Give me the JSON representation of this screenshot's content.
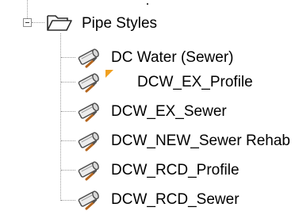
{
  "tree": {
    "root": {
      "label": "Pipe Styles",
      "icon": "folder-open-icon",
      "expanded": true
    },
    "items": [
      {
        "label": "DC Water (Sewer)",
        "icon": "pipe-style-icon",
        "flagged": false
      },
      {
        "label": "DCW_EX_Profile",
        "icon": "pipe-style-icon",
        "flagged": true
      },
      {
        "label": "DCW_EX_Sewer",
        "icon": "pipe-style-icon",
        "flagged": false
      },
      {
        "label": "DCW_NEW_Sewer Rehab",
        "icon": "pipe-style-icon",
        "flagged": false
      },
      {
        "label": "DCW_RCD_Profile",
        "icon": "pipe-style-icon",
        "flagged": false
      },
      {
        "label": "DCW_RCD_Sewer",
        "icon": "pipe-style-icon",
        "flagged": false
      }
    ]
  },
  "colors": {
    "connector": "#9a9a9a",
    "flag": "#f0a020",
    "brush_handle": "#b5651d"
  }
}
